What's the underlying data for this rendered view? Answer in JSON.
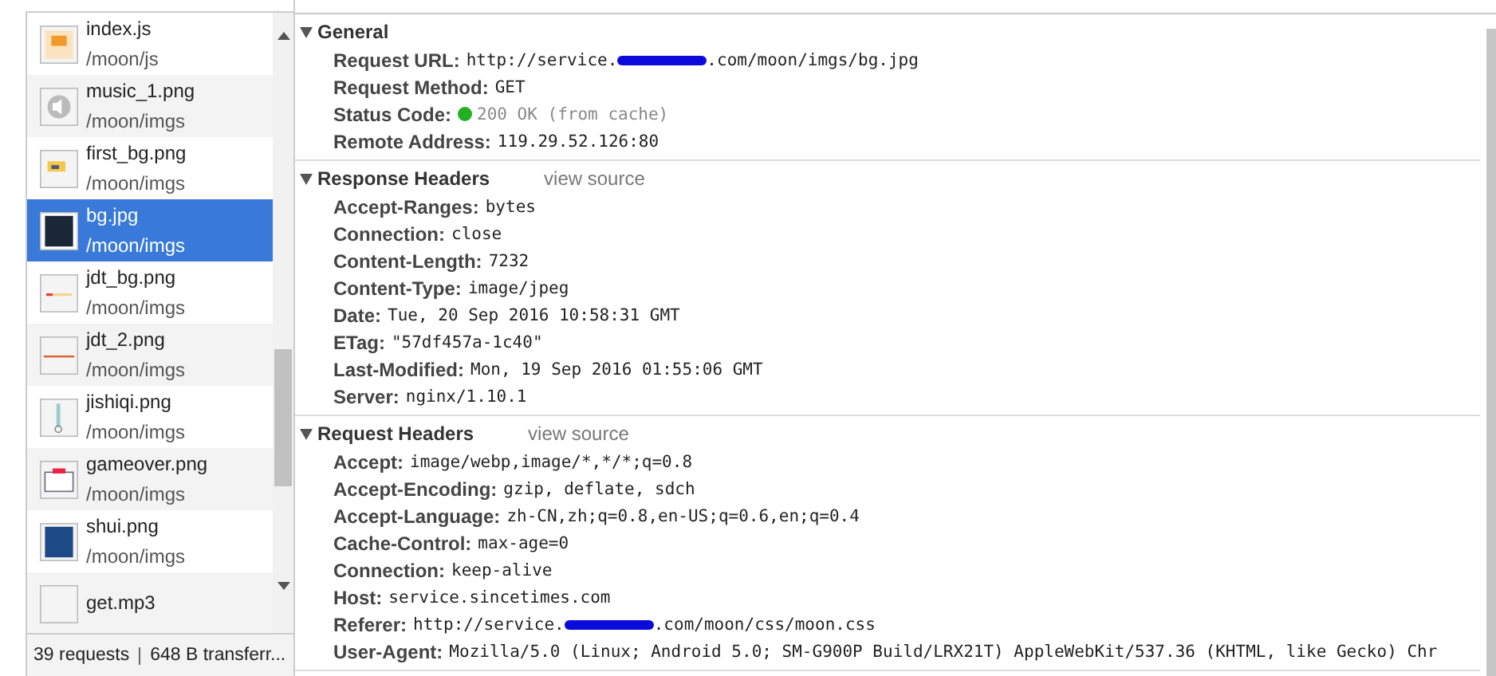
{
  "requests": [
    {
      "name": "index.js",
      "path": "/moon/js",
      "kind": "js",
      "selected": false
    },
    {
      "name": "music_1.png",
      "path": "/moon/imgs",
      "kind": "mute",
      "selected": false
    },
    {
      "name": "first_bg.png",
      "path": "/moon/imgs",
      "kind": "yellow",
      "selected": false
    },
    {
      "name": "bg.jpg",
      "path": "/moon/imgs",
      "kind": "dark",
      "selected": true
    },
    {
      "name": "jdt_bg.png",
      "path": "/moon/imgs",
      "kind": "dash",
      "selected": false
    },
    {
      "name": "jdt_2.png",
      "path": "/moon/imgs",
      "kind": "line",
      "selected": false
    },
    {
      "name": "jishiqi.png",
      "path": "/moon/imgs",
      "kind": "tube",
      "selected": false
    },
    {
      "name": "gameover.png",
      "path": "/moon/imgs",
      "kind": "panel",
      "selected": false
    },
    {
      "name": "shui.png",
      "path": "/moon/imgs",
      "kind": "blue",
      "selected": false
    },
    {
      "name": "get.mp3",
      "kind": "blank",
      "selected": false
    }
  ],
  "status_bar": {
    "requests": "39 requests",
    "transferred": "648 B transferr..."
  },
  "sections": [
    {
      "title": "General",
      "expanded": true,
      "rows": [
        {
          "key": "Request URL:",
          "value": "http://service.",
          "redacted": true,
          "value_after": ".com/moon/imgs/bg.jpg"
        },
        {
          "key": "Request Method:",
          "value": "GET"
        },
        {
          "key": "Status Code:",
          "value": "200 OK (from cache)",
          "color": "#22b022"
        },
        {
          "key": "Remote Address:",
          "value": "119.29.52.126:80"
        }
      ]
    },
    {
      "title": "Response Headers",
      "link": "view source",
      "expanded": true,
      "rows": [
        {
          "key": "Accept-Ranges:",
          "value": "bytes"
        },
        {
          "key": "Connection:",
          "value": "close"
        },
        {
          "key": "Content-Length:",
          "value": "7232"
        },
        {
          "key": "Content-Type:",
          "value": "image/jpeg"
        },
        {
          "key": "Date:",
          "value": "Tue, 20 Sep 2016 10:58:31 GMT"
        },
        {
          "key": "ETag:",
          "value": "\"57df457a-1c40\""
        },
        {
          "key": "Last-Modified:",
          "value": "Mon, 19 Sep 2016 01:55:06 GMT"
        },
        {
          "key": "Server:",
          "value": "nginx/1.10.1"
        }
      ]
    },
    {
      "title": "Request Headers",
      "link": "view source",
      "expanded": true,
      "rows": [
        {
          "key": "Accept:",
          "value": "image/webp,image/*,*/*;q=0.8"
        },
        {
          "key": "Accept-Encoding:",
          "value": "gzip, deflate, sdch"
        },
        {
          "key": "Accept-Language:",
          "value": "zh-CN,zh;q=0.8,en-US;q=0.6,en;q=0.4"
        },
        {
          "key": "Cache-Control:",
          "value": "max-age=0"
        },
        {
          "key": "Connection:",
          "value": "keep-alive"
        },
        {
          "key": "Host:",
          "value": "service.sincetimes.com"
        },
        {
          "key": "Referer:",
          "value": "http://service.",
          "redacted": true,
          "value_after": ".com/moon/css/moon.css"
        },
        {
          "key": "User-Agent:",
          "value": "Mozilla/5.0 (Linux; Android 5.0; SM-G900P Build/LRX21T) AppleWebKit/537.36 (KHTML, like Gecko) Chr"
        }
      ]
    }
  ]
}
